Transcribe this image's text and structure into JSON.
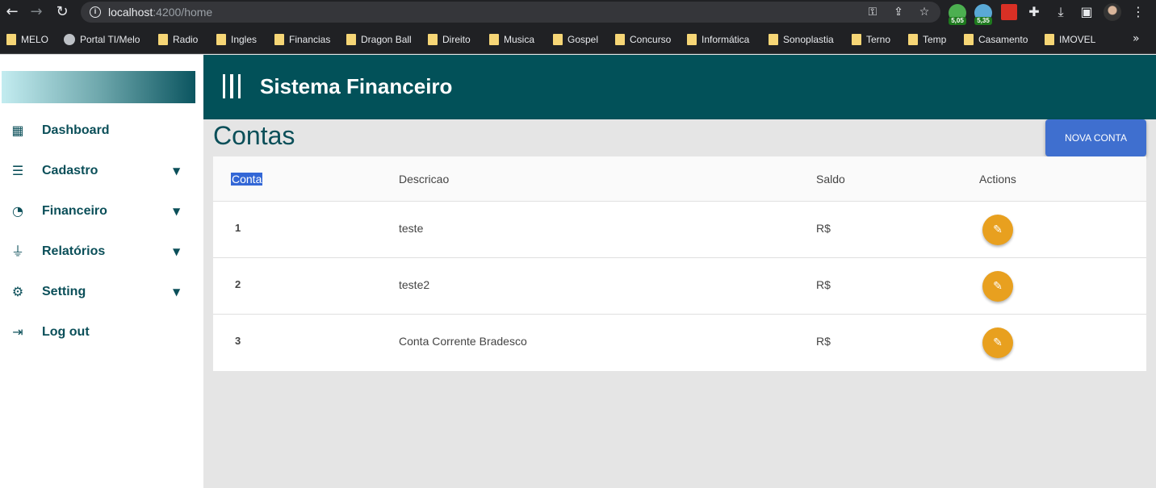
{
  "browser": {
    "url_host": "localhost",
    "url_rest": ":4200/home",
    "ext_badges": [
      "5,05",
      "5,35"
    ],
    "bookmarks": [
      "MELO",
      "Portal TI/Melo",
      "Radio",
      "Ingles",
      "Financias",
      "Dragon Ball",
      "Direito",
      "Musica",
      "Gospel",
      "Concurso",
      "Informática",
      "Sonoplastia",
      "Terno",
      "Temp",
      "Casamento",
      "IMOVEL"
    ]
  },
  "sidebar": {
    "items": [
      {
        "label": "Dashboard",
        "icon": "grid-icon",
        "has_submenu": false
      },
      {
        "label": "Cadastro",
        "icon": "stack-icon",
        "has_submenu": true
      },
      {
        "label": "Financeiro",
        "icon": "pie-chart-icon",
        "has_submenu": true
      },
      {
        "label": "Relatórios",
        "icon": "plug-icon",
        "has_submenu": true
      },
      {
        "label": "Setting",
        "icon": "gear-icon",
        "has_submenu": true
      },
      {
        "label": "Log out",
        "icon": "logout-icon",
        "has_submenu": false
      }
    ]
  },
  "header": {
    "title": "Sistema Financeiro"
  },
  "main": {
    "title": "Contas",
    "new_button": "NOVA CONTA",
    "table": {
      "columns": [
        "Conta",
        "Descricao",
        "Saldo",
        "Actions"
      ],
      "rows": [
        {
          "conta": "1",
          "descricao": "teste",
          "saldo": "R$"
        },
        {
          "conta": "2",
          "descricao": "teste2",
          "saldo": "R$"
        },
        {
          "conta": "3",
          "descricao": "Conta Corrente Bradesco",
          "saldo": "R$"
        }
      ]
    }
  },
  "colors": {
    "primary": "#025159",
    "accent_button": "#3f6fcf",
    "edit_button": "#e8a01f"
  }
}
